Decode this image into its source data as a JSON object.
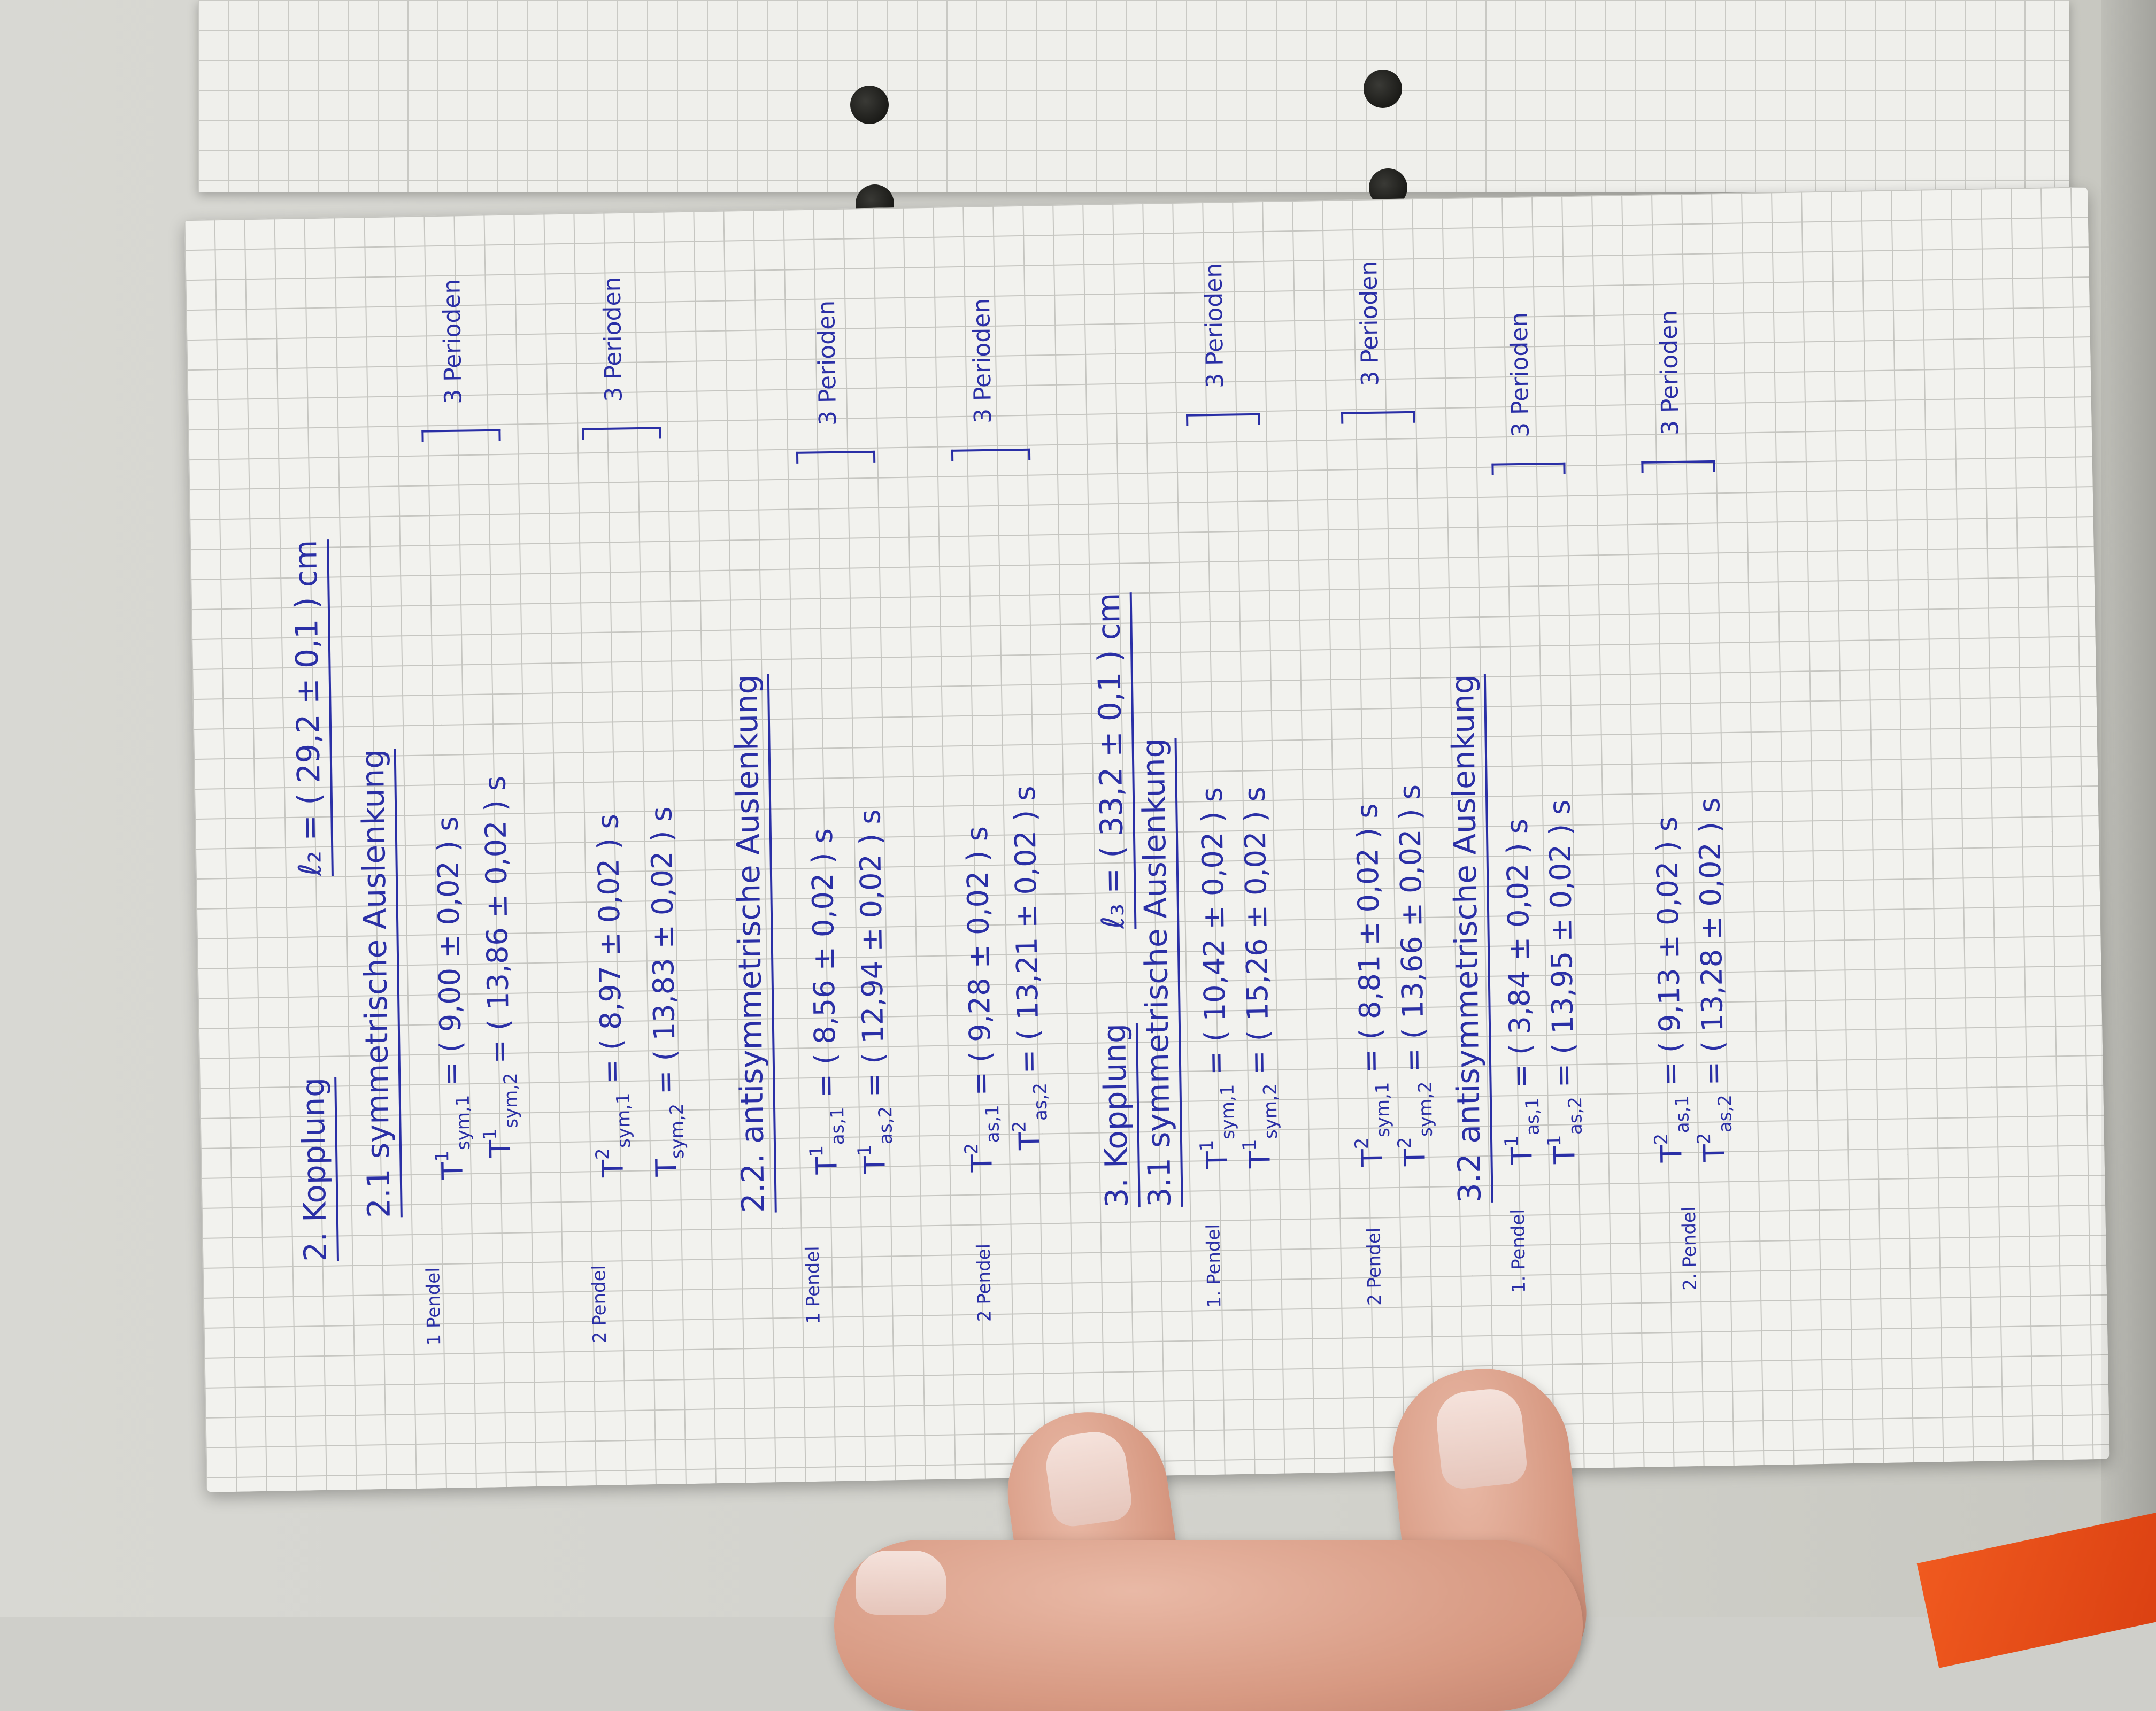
{
  "sections": {
    "s2": {
      "heading": "2. Kopplung",
      "length": "ℓ₂ = ( 29,2 ± 0,1 ) cm"
    },
    "s21": {
      "heading": "2.1 symmetrische Auslenkung",
      "pendel1_label": "1 Pendel",
      "pendel2_label": "2 Pendel",
      "rows": [
        {
          "sym": "T",
          "sup": "1",
          "sub": "sym,1",
          "value": "= ( 9,00 ± 0,02 ) s"
        },
        {
          "sym": "T",
          "sup": "1",
          "sub": "sym,2",
          "value": "= ( 13,86 ± 0,02 ) s"
        },
        {
          "sym": "T",
          "sup": "2",
          "sub": "sym,1",
          "value": "= ( 8,97 ± 0,02 ) s"
        },
        {
          "sym": "T",
          "sup": "",
          "sub": "sym,2",
          "value": "= ( 13,83 ± 0,02 ) s"
        }
      ],
      "periods_1": "3 Perioden",
      "periods_2": "3 Perioden"
    },
    "s22": {
      "heading": "2.2. antisymmetrische Auslenkung",
      "pendel1_label": "1 Pendel",
      "pendel2_label": "2 Pendel",
      "rows": [
        {
          "sym": "T",
          "sup": "1",
          "sub": "as,1",
          "value": "= ( 8,56 ± 0,02 ) s"
        },
        {
          "sym": "T",
          "sup": "1",
          "sub": "as,2",
          "value": "= ( 12,94 ± 0,02 ) s"
        },
        {
          "sym": "T",
          "sup": "2",
          "sub": "as,1",
          "value": "= ( 9,28 ± 0,02 ) s"
        },
        {
          "sym": "T",
          "sup": "2",
          "sub": "as,2",
          "value": "= ( 13,21 ± 0,02 ) s"
        }
      ],
      "periods_1": "3 Perioden",
      "periods_2": "3 Perioden"
    },
    "s3": {
      "heading": "3. Kopplung",
      "length": "ℓ₃ = ( 33,2 ± 0,1 ) cm"
    },
    "s31": {
      "heading": "3.1 symmetrische Auslenkung",
      "pendel1_label": "1. Pendel",
      "pendel2_label": "2 Pendel",
      "rows": [
        {
          "sym": "T",
          "sup": "1",
          "sub": "sym,1",
          "value": "= ( 10,42 ± 0,02 ) s"
        },
        {
          "sym": "T",
          "sup": "1",
          "sub": "sym,2",
          "value": "= ( 15,26 ± 0,02 ) s"
        },
        {
          "sym": "T",
          "sup": "2",
          "sub": "sym,1",
          "value": "= ( 8,81 ± 0,02 ) s"
        },
        {
          "sym": "T",
          "sup": "2",
          "sub": "sym,2",
          "value": "= ( 13,66 ± 0,02 ) s"
        }
      ],
      "periods_1": "3 Perioden",
      "periods_2": "3 Perioden"
    },
    "s32": {
      "heading": "3.2 antisymmetrische Auslenkung",
      "pendel1_label": "1. Pendel",
      "pendel2_label": "2. Pendel",
      "rows": [
        {
          "sym": "T",
          "sup": "1",
          "sub": "as,1",
          "value": "= ( 3,84 ± 0,02 ) s"
        },
        {
          "sym": "T",
          "sup": "1",
          "sub": "as,2",
          "value": "= ( 13,95 ± 0,02 ) s"
        },
        {
          "sym": "T",
          "sup": "2",
          "sub": "as,1",
          "value": "= ( 9,13 ± 0,02 ) s"
        },
        {
          "sym": "T",
          "sup": "2",
          "sub": "as,2",
          "value": "= ( 13,28 ± 0,02 ) s"
        }
      ],
      "periods_1": "3 Perioden",
      "periods_2": "3 Perioden"
    }
  },
  "colors": {
    "ink": "#2a2fa6",
    "paper": "#f2f2ee",
    "grid": "#c6c6c1",
    "skin": "#d79982",
    "orange_object": "#f05a1f"
  }
}
